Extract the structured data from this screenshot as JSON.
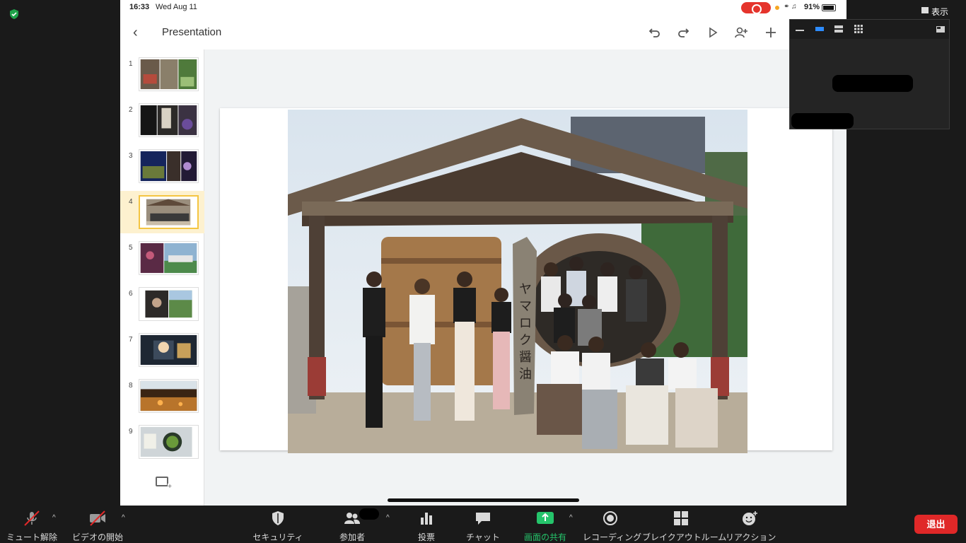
{
  "ipad": {
    "status": {
      "time": "16:33",
      "date": "Wed Aug 11",
      "battery": "91%"
    },
    "app": {
      "title": "Presentation"
    },
    "slides": [
      {
        "num": "1"
      },
      {
        "num": "2"
      },
      {
        "num": "3"
      },
      {
        "num": "4",
        "active": true
      },
      {
        "num": "5"
      },
      {
        "num": "6"
      },
      {
        "num": "7"
      },
      {
        "num": "8"
      },
      {
        "num": "9"
      }
    ],
    "slide_sign": "ヤマロク醤油"
  },
  "zoom": {
    "view_label": "表示",
    "toolbar": {
      "mute": "ミュート解除",
      "video": "ビデオの開始",
      "security": "セキュリティ",
      "participants": "参加者",
      "poll": "投票",
      "chat": "チャット",
      "share": "画面の共有",
      "record": "レコーディング",
      "breakout": "ブレイクアウトルーム",
      "reaction": "リアクション",
      "leave": "退出"
    }
  },
  "colors": {
    "accent_green": "#25c46b",
    "leave_red": "#e02828",
    "active_slide": "#f4c542",
    "record_red": "#e5342c"
  }
}
